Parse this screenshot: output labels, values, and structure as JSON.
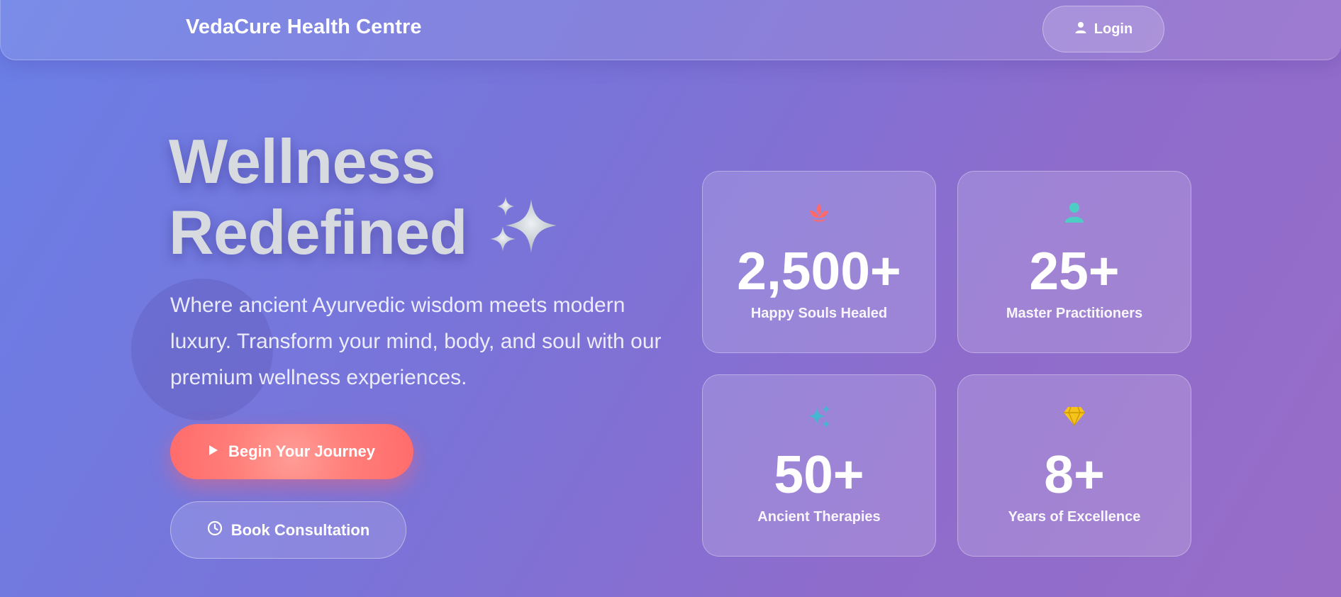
{
  "header": {
    "brand": "VedaCure Health Centre",
    "login_label": "Login",
    "login_icon": "user-icon"
  },
  "hero": {
    "title_line1": "Wellness",
    "title_line2": "Redefined",
    "title_icon": "sparkles-icon",
    "subtitle": "Where ancient Ayurvedic wisdom meets modern luxury. Transform your mind, body, and soul with our premium wellness experiences.",
    "primary_cta": {
      "label": "Begin Your Journey",
      "icon": "play-icon"
    },
    "secondary_cta": {
      "label": "Book Consultation",
      "icon": "clock-icon"
    }
  },
  "stats": [
    {
      "value": "2,500+",
      "label": "Happy Souls Healed",
      "icon": "lotus-icon",
      "color": "#ff6b6b"
    },
    {
      "value": "25+",
      "label": "Master Practitioners",
      "icon": "user-md-icon",
      "color": "#4ecdc4"
    },
    {
      "value": "50+",
      "label": "Ancient Therapies",
      "icon": "sparkles-icon",
      "color": "#45b7d1"
    },
    {
      "value": "8+",
      "label": "Years of Excellence",
      "icon": "gem-icon",
      "color": "#f7c21b"
    }
  ],
  "colors": {
    "accent_coral": "#ff6b6b",
    "accent_teal": "#4ecdc4",
    "accent_blue": "#45b7d1",
    "accent_gold": "#f7c21b",
    "background_start": "#6a7fe6",
    "background_end": "#986dc8"
  }
}
